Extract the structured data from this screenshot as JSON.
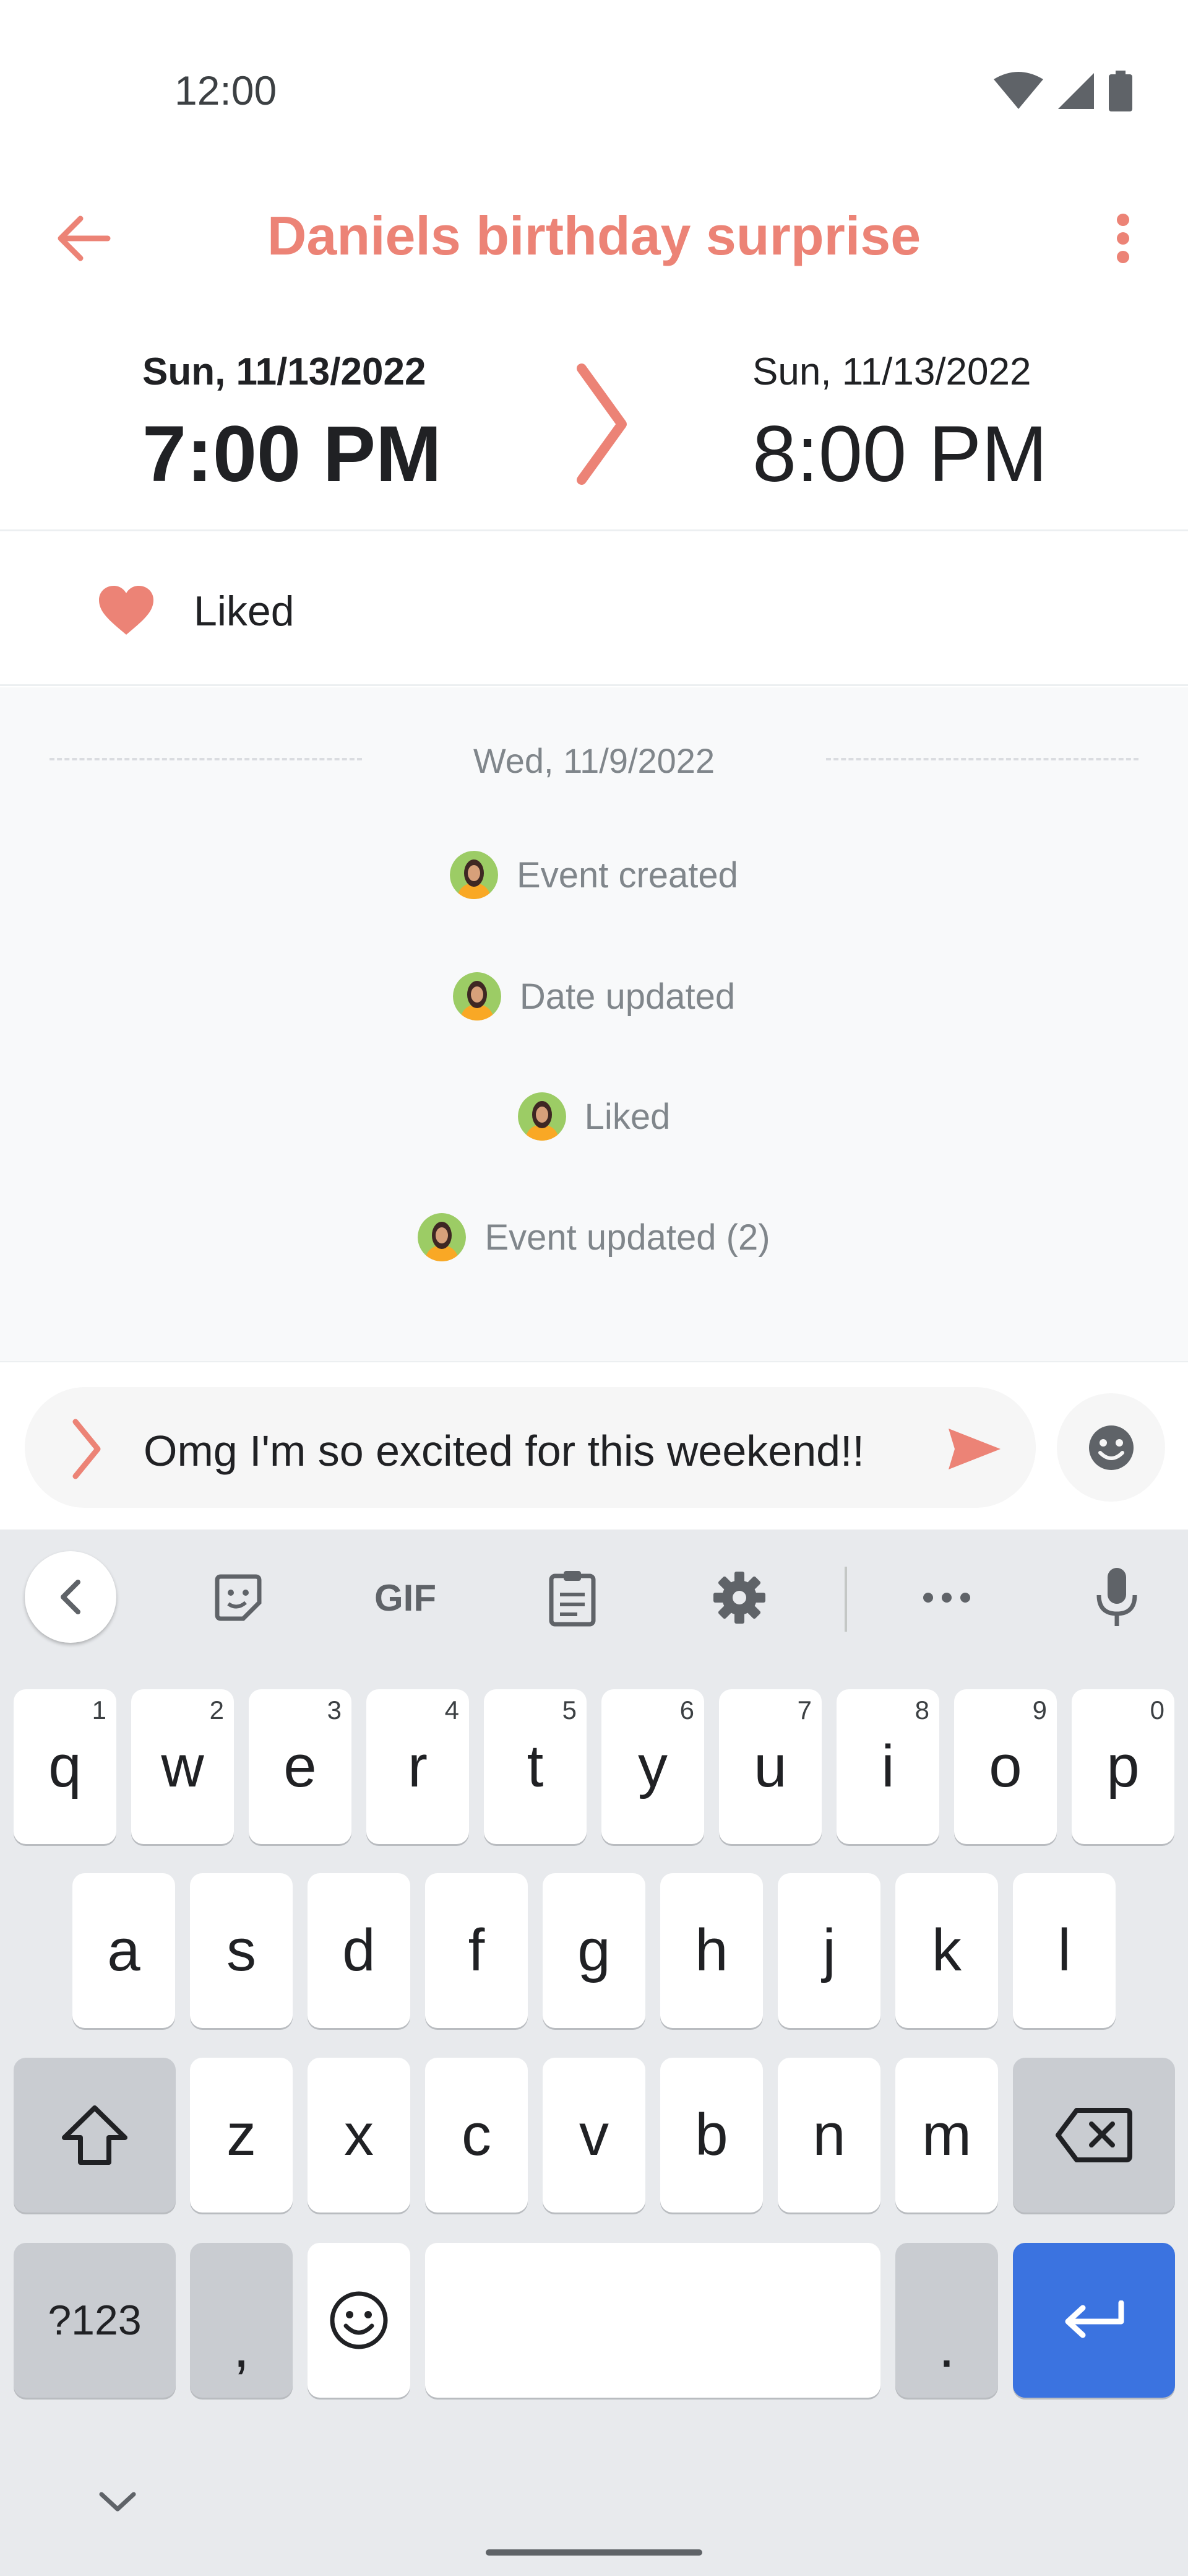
{
  "status_bar": {
    "time": "12:00",
    "icons": [
      "wifi-icon",
      "cellular-signal-icon",
      "battery-icon"
    ]
  },
  "app_bar": {
    "title": "Daniels birthday surprise",
    "back_icon": "arrow-back-icon",
    "menu_icon": "more-vert-icon"
  },
  "event": {
    "start": {
      "date": "Sun, 11/13/2022",
      "time": "7:00 PM"
    },
    "end": {
      "date": "Sun, 11/13/2022",
      "time": "8:00 PM"
    },
    "range_icon": "chevron-right-icon"
  },
  "liked": {
    "icon": "heart-icon",
    "label": "Liked"
  },
  "feed": {
    "date": "Wed, 11/9/2022",
    "items": [
      {
        "text": "Event created"
      },
      {
        "text": "Date updated"
      },
      {
        "text": "Liked"
      },
      {
        "text": "Event updated (2)"
      }
    ]
  },
  "composer": {
    "value": "Omg I'm so excited for this weekend!!",
    "send_icon": "send-icon",
    "emoji_icon": "emoji-icon"
  },
  "keyboard": {
    "toolbar": [
      "back-chevron-icon",
      "sticker-icon",
      "gif-icon",
      "clipboard-icon",
      "settings-icon",
      "more-horiz-icon",
      "mic-icon"
    ],
    "gif_label": "GIF",
    "row1": [
      {
        "k": "q",
        "h": "1"
      },
      {
        "k": "w",
        "h": "2"
      },
      {
        "k": "e",
        "h": "3"
      },
      {
        "k": "r",
        "h": "4"
      },
      {
        "k": "t",
        "h": "5"
      },
      {
        "k": "y",
        "h": "6"
      },
      {
        "k": "u",
        "h": "7"
      },
      {
        "k": "i",
        "h": "8"
      },
      {
        "k": "o",
        "h": "9"
      },
      {
        "k": "p",
        "h": "0"
      }
    ],
    "row2": [
      "a",
      "s",
      "d",
      "f",
      "g",
      "h",
      "j",
      "k",
      "l"
    ],
    "row3": [
      "z",
      "x",
      "c",
      "v",
      "b",
      "n",
      "m"
    ],
    "symbols_label": "?123",
    "comma_label": ",",
    "period_label": "."
  },
  "colors": {
    "accent": "#ec8376",
    "enter_key": "#3b73e0"
  }
}
